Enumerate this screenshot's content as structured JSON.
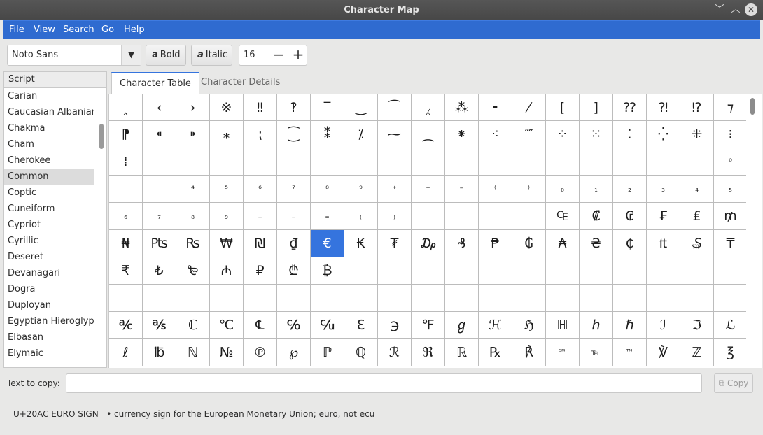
{
  "window": {
    "title": "Character Map"
  },
  "menu": [
    "File",
    "View",
    "Search",
    "Go",
    "Help"
  ],
  "toolbar": {
    "font": "Noto Sans",
    "bold_label": "Bold",
    "italic_label": "Italic",
    "size": "16",
    "bold_icon": "a",
    "italic_icon": "a"
  },
  "sidebar": {
    "header": "Script",
    "items": [
      "Carian",
      "Caucasian Albanian",
      "Chakma",
      "Cham",
      "Cherokee",
      "Common",
      "Coptic",
      "Cuneiform",
      "Cypriot",
      "Cyrillic",
      "Deseret",
      "Devanagari",
      "Dogra",
      "Duployan",
      "Egyptian Hieroglyphs",
      "Elbasan",
      "Elymaic"
    ],
    "selected": "Common"
  },
  "tabs": [
    "Character Table",
    "Character Details"
  ],
  "grid": {
    "rows": [
      [
        "‸",
        "‹",
        "›",
        "※",
        "‼",
        "‽",
        "‾",
        "‿",
        "⁀",
        "⁁",
        "⁂",
        "⁃",
        "⁄",
        "⁅",
        "⁆",
        "⁇",
        "⁈",
        "⁉",
        "⁊"
      ],
      [
        "⁋",
        "⁌",
        "⁍",
        "⁎",
        "⁏",
        "⁐",
        "⁑",
        "⁒",
        "⁓",
        "⁔",
        "⁕",
        "⁖",
        "⁗",
        "⁘",
        "⁙",
        "⁚",
        "⁛",
        "⁜",
        "⁝"
      ],
      [
        "⁞",
        "",
        "",
        "",
        "",
        "",
        "",
        "",
        "",
        "",
        "",
        "",
        "",
        "",
        "",
        "",
        "",
        "",
        "⁰"
      ],
      [
        "",
        "",
        "⁴",
        "⁵",
        "⁶",
        "⁷",
        "⁸",
        "⁹",
        "⁺",
        "⁻",
        "⁼",
        "⁽",
        "⁾",
        "₀",
        "₁",
        "₂",
        "₃",
        "₄",
        "₅"
      ],
      [
        "₆",
        "₇",
        "₈",
        "₉",
        "₊",
        "₋",
        "₌",
        "₍",
        "₎",
        "",
        "",
        "",
        "",
        "₠",
        "₡",
        "₢",
        "₣",
        "₤",
        "₥"
      ],
      [
        "₦",
        "₧",
        "₨",
        "₩",
        "₪",
        "₫",
        "€",
        "₭",
        "₮",
        "₯",
        "₰",
        "₱",
        "₲",
        "₳",
        "₴",
        "₵",
        "₶",
        "₷",
        "₸"
      ],
      [
        "₹",
        "₺",
        "₻",
        "₼",
        "₽",
        "₾",
        "₿",
        "",
        "",
        "",
        "",
        "",
        "",
        "",
        "",
        "",
        "",
        "",
        ""
      ],
      [
        "",
        "",
        "",
        "",
        "",
        "",
        "",
        "",
        "",
        "",
        "",
        "",
        "",
        "",
        "",
        "",
        "",
        "",
        ""
      ],
      [
        "℀",
        "℁",
        "ℂ",
        "℃",
        "℄",
        "℅",
        "℆",
        "ℇ",
        "℈",
        "℉",
        "ℊ",
        "ℋ",
        "ℌ",
        "ℍ",
        "ℎ",
        "ℏ",
        "ℐ",
        "ℑ",
        "ℒ"
      ],
      [
        "ℓ",
        "℔",
        "ℕ",
        "№",
        "℗",
        "℘",
        "ℙ",
        "ℚ",
        "ℛ",
        "ℜ",
        "ℝ",
        "℞",
        "℟",
        "℠",
        "℡",
        "™",
        "℣",
        "ℤ",
        "℥"
      ]
    ],
    "selected": "€"
  },
  "copy": {
    "label": "Text to copy:",
    "value": "",
    "button": "Copy"
  },
  "status": "U+20AC EURO SIGN   • currency sign for the European Monetary Union; euro, not ecu"
}
